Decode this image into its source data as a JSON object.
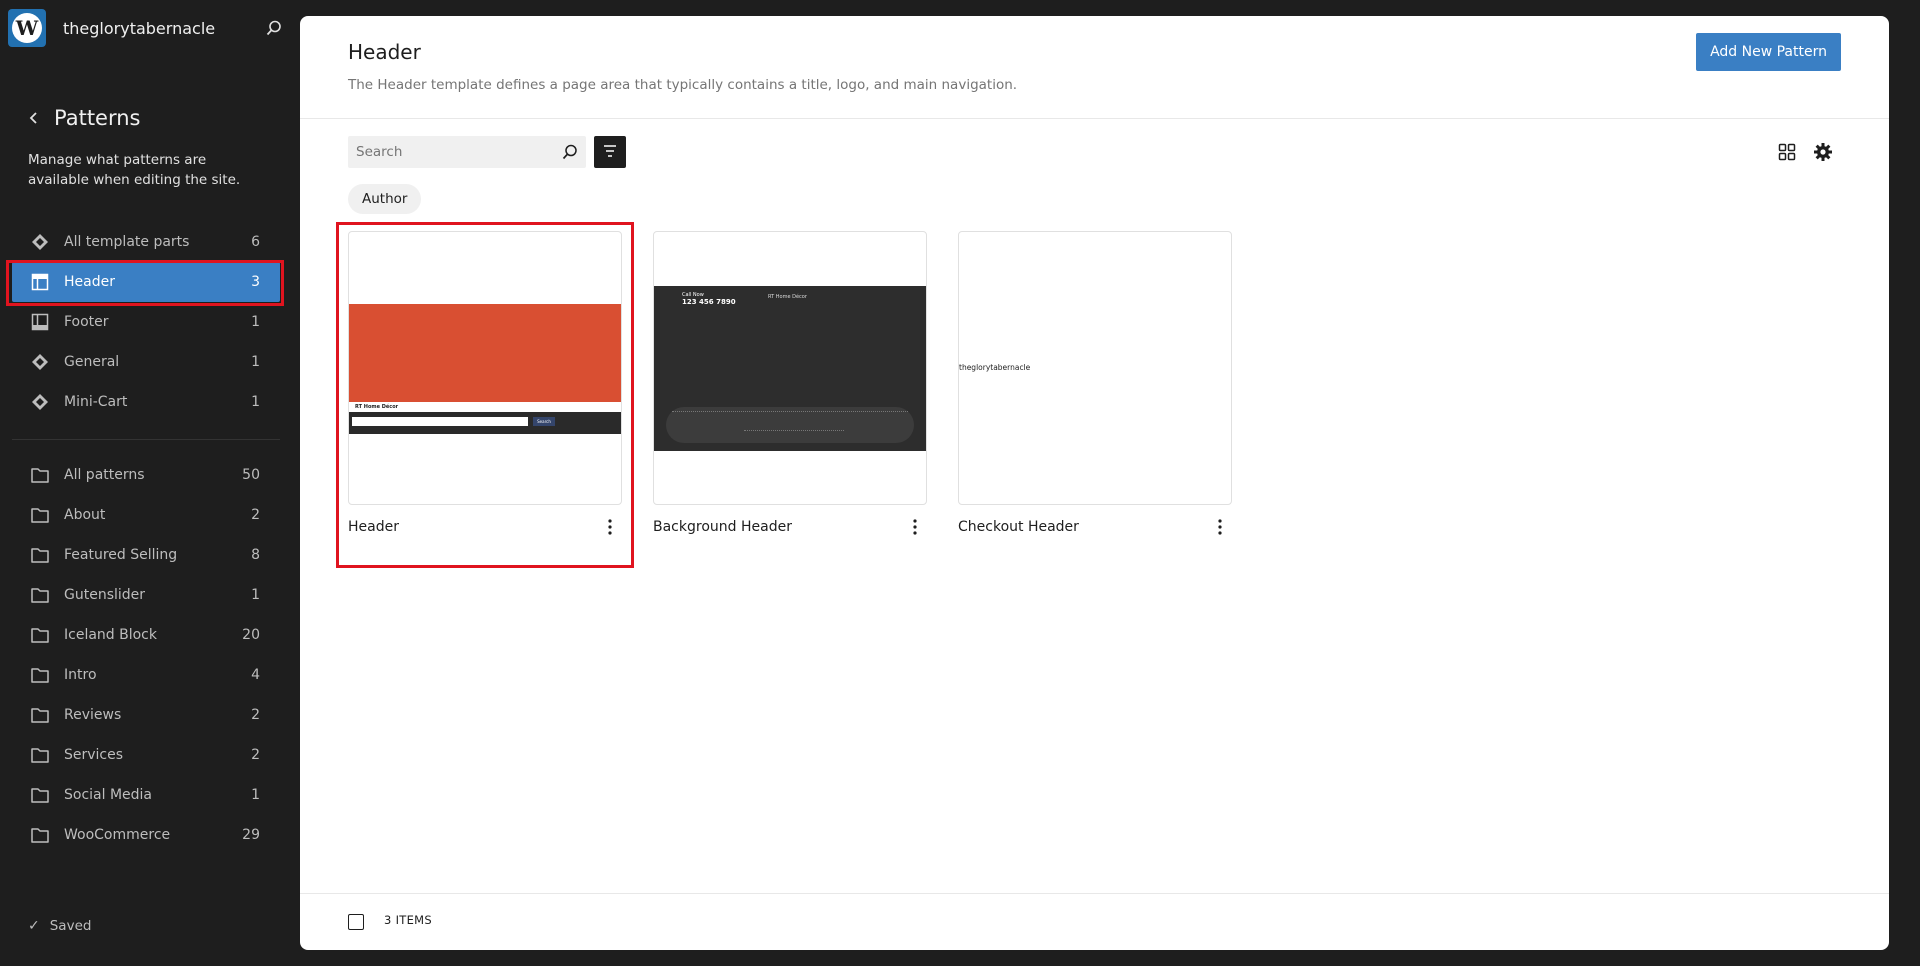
{
  "site": {
    "name": "theglorytabernacle"
  },
  "sidebar": {
    "title": "Patterns",
    "description": "Manage what patterns are available when editing the site.",
    "template_parts": [
      {
        "label": "All template parts",
        "count": "6",
        "icon": "symbol-filled-icon"
      },
      {
        "label": "Header",
        "count": "3",
        "icon": "header-layout-icon",
        "active": true
      },
      {
        "label": "Footer",
        "count": "1",
        "icon": "footer-layout-icon"
      },
      {
        "label": "General",
        "count": "1",
        "icon": "symbol-filled-icon"
      },
      {
        "label": "Mini-Cart",
        "count": "1",
        "icon": "symbol-filled-icon"
      }
    ],
    "categories": [
      {
        "label": "All patterns",
        "count": "50"
      },
      {
        "label": "About",
        "count": "2"
      },
      {
        "label": "Featured Selling",
        "count": "8"
      },
      {
        "label": "Gutenslider",
        "count": "1"
      },
      {
        "label": "Iceland Block",
        "count": "20"
      },
      {
        "label": "Intro",
        "count": "4"
      },
      {
        "label": "Reviews",
        "count": "2"
      },
      {
        "label": "Services",
        "count": "2"
      },
      {
        "label": "Social Media",
        "count": "1"
      },
      {
        "label": "WooCommerce",
        "count": "29"
      }
    ],
    "saved": "Saved"
  },
  "main": {
    "title": "Header",
    "description": "The Header template defines a page area that typically contains a title, logo, and main navigation.",
    "add_button": "Add New Pattern",
    "search_placeholder": "Search",
    "filter_chip": "Author",
    "items_count": "3 ITEMS",
    "accent_color": "#3a7fc4",
    "cards": [
      {
        "title": "Header",
        "preview": {
          "nav_text": "RT Home Décor",
          "search_label": "Search"
        }
      },
      {
        "title": "Background Header",
        "preview": {
          "small_text": "Call Now",
          "phone": "123 456 7890",
          "site_title": "RT Home Décor"
        }
      },
      {
        "title": "Checkout Header",
        "preview": {
          "site_text": "theglorytabernacle"
        }
      }
    ]
  }
}
